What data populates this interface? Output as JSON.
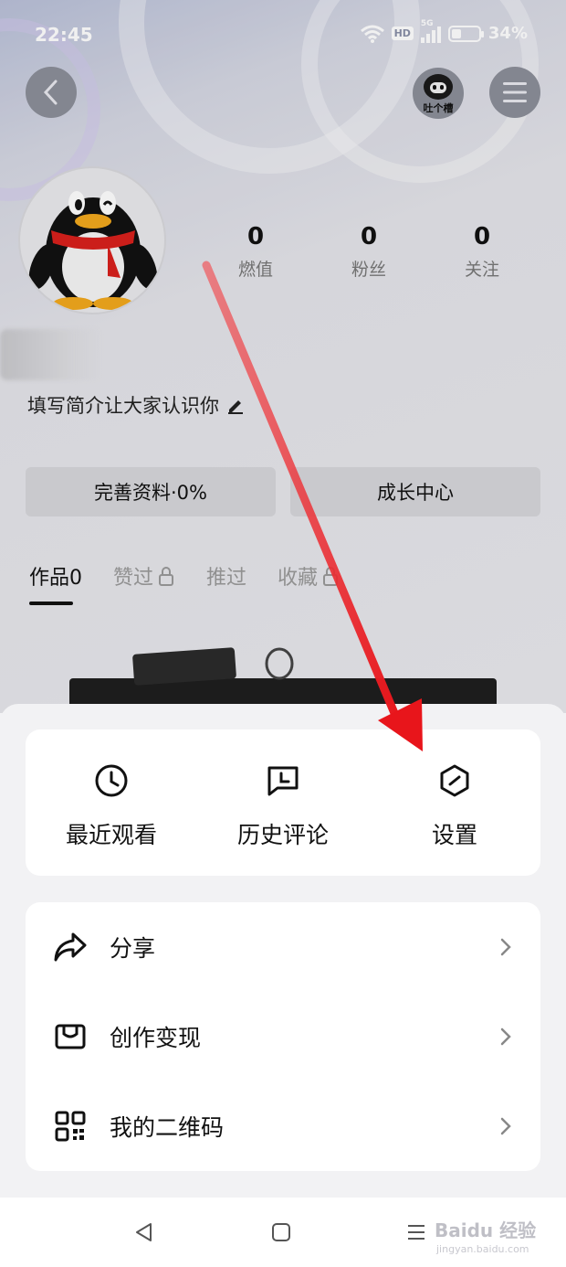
{
  "status_bar": {
    "time": "22:45",
    "hd_badge": "HD",
    "network": "5G",
    "battery_level": 0.34,
    "battery_text": "34%"
  },
  "header": {
    "back_icon": "chevron-left-icon",
    "tucao_label": "吐个槽",
    "menu_icon": "hamburger-menu-icon"
  },
  "profile": {
    "stats": [
      {
        "value": "0",
        "label": "燃值"
      },
      {
        "value": "0",
        "label": "粉丝"
      },
      {
        "value": "0",
        "label": "关注"
      }
    ],
    "bio": "填写简介让大家认识你",
    "complete_profile_button": "完善资料·0%",
    "growth_center_button": "成长中心"
  },
  "tabs": [
    {
      "label": "作品0",
      "active": true,
      "locked": false
    },
    {
      "label": "赞过",
      "active": false,
      "locked": true
    },
    {
      "label": "推过",
      "active": false,
      "locked": false
    },
    {
      "label": "收藏",
      "active": false,
      "locked": true
    }
  ],
  "sheet": {
    "quick_actions": [
      {
        "label": "最近观看",
        "icon": "clock-icon"
      },
      {
        "label": "历史评论",
        "icon": "comment-icon"
      },
      {
        "label": "设置",
        "icon": "settings-hexagon-icon"
      }
    ],
    "menu_items": [
      {
        "label": "分享",
        "icon": "share-arrow-icon"
      },
      {
        "label": "创作变现",
        "icon": "monetize-bag-icon"
      },
      {
        "label": "我的二维码",
        "icon": "qr-code-icon"
      }
    ]
  },
  "watermark": {
    "text": "Baidu 经验",
    "sub": "jingyan.baidu.com"
  },
  "colors": {
    "annotation_arrow": "#e8151b",
    "sheet_bg": "#f2f2f4",
    "card_bg": "#ffffff"
  }
}
